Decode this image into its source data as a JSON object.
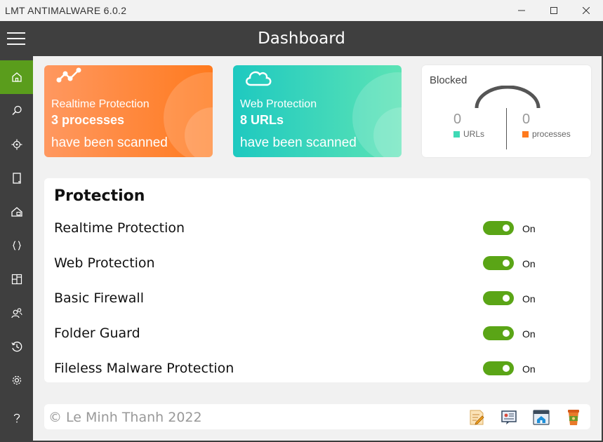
{
  "window": {
    "title": "LMT ANTIMALWARE 6.0.2"
  },
  "header": {
    "title": "Dashboard"
  },
  "sidebar": {
    "items": [
      {
        "icon": "home-icon",
        "active": true
      },
      {
        "icon": "search-icon"
      },
      {
        "icon": "scan-target-icon"
      },
      {
        "icon": "device-icon"
      },
      {
        "icon": "home-lock-icon"
      },
      {
        "icon": "braces-icon"
      },
      {
        "icon": "modules-icon"
      },
      {
        "icon": "users-icon"
      },
      {
        "icon": "history-icon"
      },
      {
        "icon": "gear-icon"
      },
      {
        "icon": "help-icon"
      }
    ]
  },
  "cards": {
    "realtime": {
      "label": "Realtime Protection",
      "count": "3 processes",
      "foot": "have been scanned",
      "icon": "network-icon",
      "color": "#ff7a1e"
    },
    "web": {
      "label": "Web Protection",
      "count": "8 URLs",
      "foot": "have been scanned",
      "icon": "cloud-icon",
      "color": "#3fd5bb"
    }
  },
  "blocked": {
    "title": "Blocked",
    "urls": {
      "value": "0",
      "label": "URLs",
      "color": "#3fd9b5"
    },
    "processes": {
      "value": "0",
      "label": "processes",
      "color": "#ff7a1e"
    }
  },
  "protection": {
    "title": "Protection",
    "items": [
      {
        "name": "Realtime Protection",
        "state": "On"
      },
      {
        "name": "Web Protection",
        "state": "On"
      },
      {
        "name": "Basic Firewall",
        "state": "On"
      },
      {
        "name": "Folder Guard",
        "state": "On"
      },
      {
        "name": "Fileless Malware Protection",
        "state": "On"
      }
    ]
  },
  "footer": {
    "copyright": "© Le Minh Thanh 2022",
    "icons": [
      "notes-icon",
      "support-icon",
      "website-icon",
      "coffee-icon"
    ]
  },
  "colors": {
    "accent": "#5a9d1c",
    "toggle_on": "#5aa516",
    "chrome": "#3f3f3f"
  }
}
